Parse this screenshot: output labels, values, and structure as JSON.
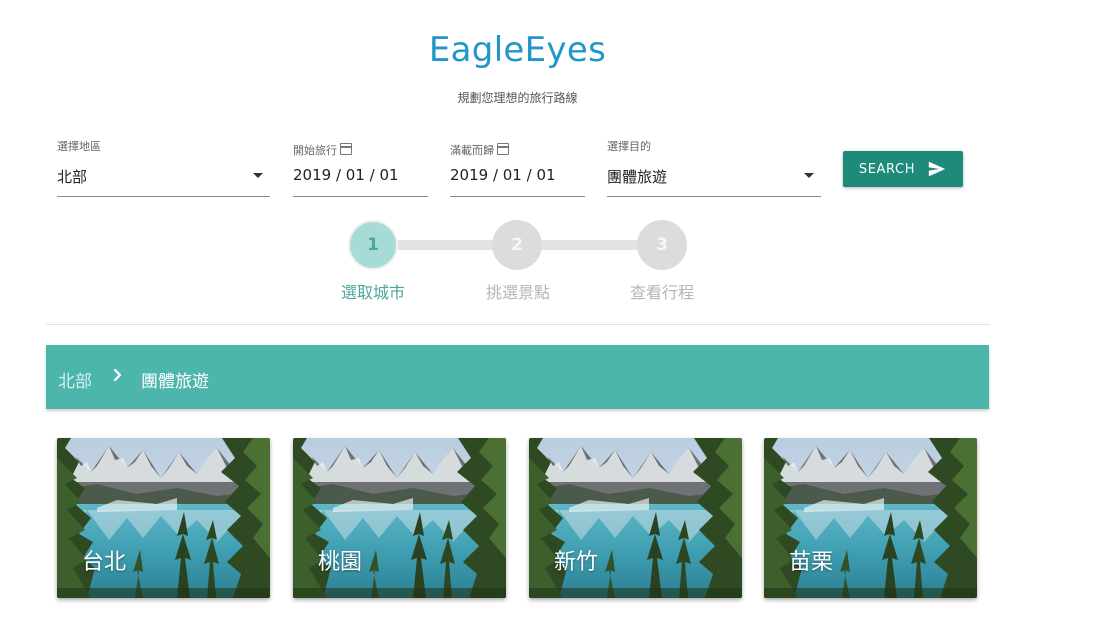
{
  "app": {
    "title": "EagleEyes",
    "subtitle": "規劃您理想的旅行路線"
  },
  "form": {
    "region": {
      "label": "選擇地區",
      "value": "北部"
    },
    "start": {
      "label": "開始旅行",
      "value": "2019 / 01 / 01",
      "icon": "calendar-icon"
    },
    "end": {
      "label": "滿載而歸",
      "value": "2019 / 01 / 01",
      "icon": "calendar-icon"
    },
    "purpose": {
      "label": "選擇目的",
      "value": "團體旅遊"
    },
    "search_label": "SEARCH",
    "search_icon": "send-icon"
  },
  "stepper": {
    "steps": [
      {
        "number": "1",
        "label": "選取城市",
        "state": "active"
      },
      {
        "number": "2",
        "label": "挑選景點",
        "state": "inactive"
      },
      {
        "number": "3",
        "label": "查看行程",
        "state": "inactive"
      }
    ]
  },
  "breadcrumb": {
    "items": [
      "北部",
      "團體旅遊"
    ],
    "separator_icon": "chevron-right-icon"
  },
  "cities": [
    {
      "name": "台北"
    },
    {
      "name": "桃園"
    },
    {
      "name": "新竹"
    },
    {
      "name": "苗栗"
    }
  ],
  "colors": {
    "accent": "#4db6ac",
    "primary_button": "#1e8a7a",
    "title": "#2196c9"
  }
}
